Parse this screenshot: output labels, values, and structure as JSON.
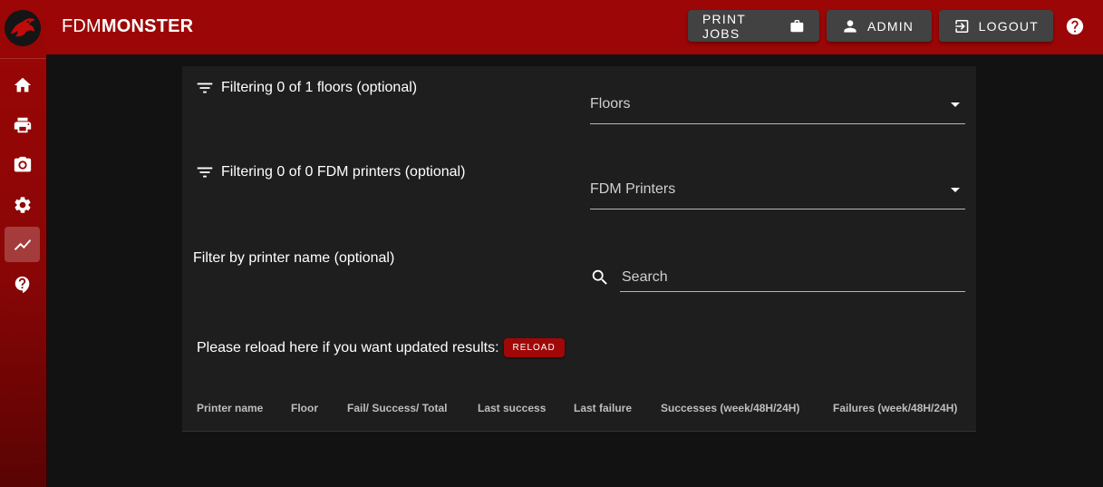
{
  "app": {
    "brand_light": "FDM",
    "brand_bold": "MONSTER",
    "accent_color": "#9c0606"
  },
  "sidebar": {
    "items": [
      {
        "icon": "home-icon"
      },
      {
        "icon": "printer-icon"
      },
      {
        "icon": "camera-icon"
      },
      {
        "icon": "gear-icon"
      },
      {
        "icon": "chart-line-icon",
        "active": true
      },
      {
        "icon": "help-icon"
      }
    ]
  },
  "header": {
    "print_jobs_label": "PRINT JOBS",
    "admin_label": "ADMIN",
    "logout_label": "LOGOUT",
    "help_icon": "help-circle-icon"
  },
  "filters": {
    "floors_label": "Filtering 0 of 1 floors (optional)",
    "floors_select": "Floors",
    "printers_label": "Filtering 0 of 0 FDM printers (optional)",
    "printers_select": "FDM Printers",
    "name_label": "Filter by printer name (optional)",
    "search_placeholder": "Search"
  },
  "reload": {
    "text": "Please reload here if you want updated results:",
    "button_label": "RELOAD"
  },
  "table": {
    "columns": [
      "Printer name",
      "Floor",
      "Fail/ Success/ Total",
      "Last success",
      "Last failure",
      "Successes (week/48H/24H)",
      "Failures (week/48H/24H)"
    ],
    "rows": []
  }
}
